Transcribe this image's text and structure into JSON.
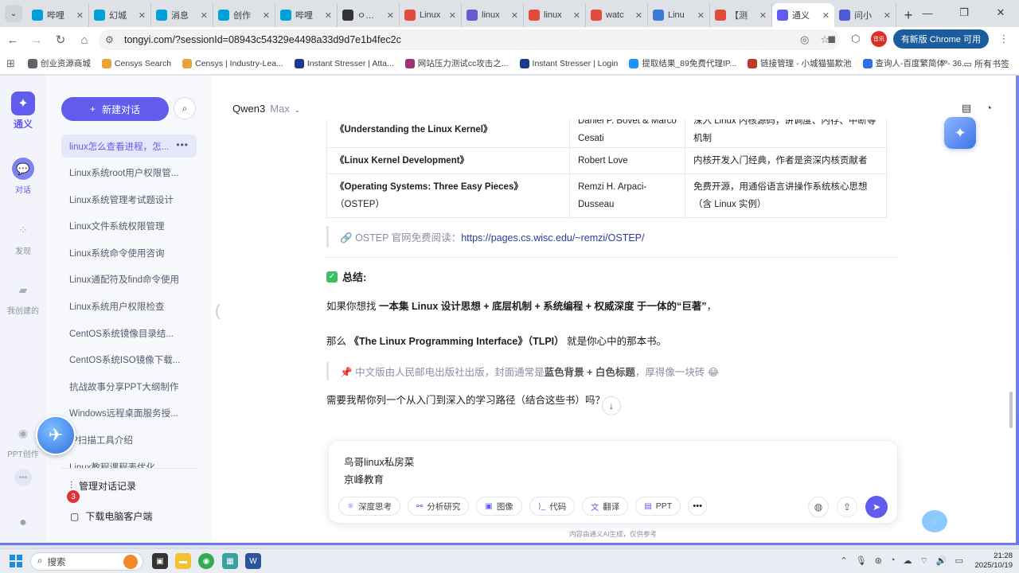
{
  "browser": {
    "tabs": [
      {
        "title": "哔哩",
        "icon": "bilibili-icon",
        "color": "#00a1d6"
      },
      {
        "title": "幻城",
        "icon": "bilibili-icon",
        "color": "#00a1d6"
      },
      {
        "title": "消息",
        "icon": "bilibili-icon",
        "color": "#00a1d6"
      },
      {
        "title": "创作",
        "icon": "bilibili-icon",
        "color": "#00a1d6"
      },
      {
        "title": "哔哩",
        "icon": "bilibili-icon",
        "color": "#00a1d6"
      },
      {
        "title": "ㅇ…",
        "icon": "grid-icon",
        "color": "#333333"
      },
      {
        "title": "Linux",
        "icon": "c-icon",
        "color": "#e34c3c"
      },
      {
        "title": "linux",
        "icon": "purple-icon",
        "color": "#6a5acd"
      },
      {
        "title": "linux",
        "icon": "c-icon",
        "color": "#e34c3c"
      },
      {
        "title": "watc",
        "icon": "c-icon",
        "color": "#e34c3c"
      },
      {
        "title": "Linu",
        "icon": "cloud-icon",
        "color": "#3a7bd5"
      },
      {
        "title": "【测",
        "icon": "c-icon",
        "color": "#e34c3c"
      },
      {
        "title": "通义",
        "icon": "tongyi-icon",
        "color": "#615ced"
      },
      {
        "title": "问小",
        "icon": "infinity-icon",
        "color": "#4f5bd5"
      }
    ],
    "active_tab_index": 12,
    "url": "tongyi.com/?sessionId=08943c54329e4498a33d9d7e1b4fec2c",
    "profile_badge": "音讯",
    "update_label": "有新版 Chrome 可用",
    "bookmarks": [
      {
        "label": "创业资源商城",
        "icon": "globe-icon",
        "color": "#5f6368"
      },
      {
        "label": "Censys Search",
        "icon": "censys-icon",
        "color": "#e8a33d"
      },
      {
        "label": "Censys | Industry-Lea...",
        "icon": "censys-icon",
        "color": "#e8a33d"
      },
      {
        "label": "Instant Stresser | Atta...",
        "icon": "stresser-icon",
        "color": "#1a3a8a"
      },
      {
        "label": "网站压力测试cc攻击之...",
        "icon": "web-icon",
        "color": "#a0307a"
      },
      {
        "label": "Instant Stresser | Login",
        "icon": "stresser-icon",
        "color": "#1a3a8a"
      },
      {
        "label": "提取结果_89免费代理IP...",
        "icon": "proxy-icon",
        "color": "#1e90ff"
      },
      {
        "label": "链接管理 - 小城猫猫欺池",
        "icon": "m-icon",
        "color": "#c0392b"
      },
      {
        "label": "查询人-百度繁简体 - 36...",
        "icon": "search-tool-icon",
        "color": "#2f6fe0"
      }
    ],
    "all_bookmarks_label": "所有书签"
  },
  "app": {
    "logo_text": "通义",
    "rail": [
      {
        "label": "对话",
        "icon": "chat-icon",
        "active": true
      },
      {
        "label": "发现",
        "icon": "discover-icon",
        "active": false
      },
      {
        "label": "我创建的",
        "icon": "folder-icon",
        "active": false
      },
      {
        "label": "PPT创作",
        "icon": "ppt-icon",
        "active": false
      }
    ],
    "new_chat_label": "新建对话",
    "conversations": [
      "linux怎么查看进程，怎...",
      "Linux系统root用户权限管...",
      "Linux系统管理考试题设计",
      "Linux文件系统权限管理",
      "Linux系统命令使用咨询",
      "Linux通配符及find命令使用",
      "Linux系统用户权限检查",
      "CentOS系统镜像目录结...",
      "CentOS系统ISO镜像下载...",
      "抗战故事分享PPT大纲制作",
      "Windows远程桌面服务授...",
      "IP扫描工具介绍",
      "Linux教程课程表优化..."
    ],
    "manage_label": "管理对话记录",
    "download_label": "下载电脑客户端",
    "notif_count": "3",
    "model_name": "Qwen3",
    "model_tier": "Max"
  },
  "message": {
    "table": [
      {
        "book": "《Understanding the Linux Kernel》",
        "sub": "",
        "author": "Daniel P. Bovet & Marco Cesati",
        "desc": "深入 Linux 内核源码，讲调度、内存、中断等机制"
      },
      {
        "book": "《Linux Kernel Development》",
        "sub": "",
        "author": "Robert Love",
        "desc": "内核开发入门经典，作者是资深内核贡献者"
      },
      {
        "book": "《Operating Systems: Three Easy Pieces》",
        "sub": "（OSTEP）",
        "author": "Remzi H. Arpaci-Dusseau",
        "desc": "免费开源，用通俗语言讲操作系统核心思想（含 Linux 实例）"
      }
    ],
    "ostep_prefix": "OSTEP 官网免费阅读：",
    "ostep_link": "https://pages.cs.wisc.edu/~remzi/OSTEP/",
    "summary_title": "总结:",
    "p1_prefix": "如果你想找 ",
    "p1_bold": "一本集 Linux 设计思想 + 底层机制 + 系统编程 + 权威深度 于一体的“巨著”",
    "p1_suffix": "，",
    "p2_prefix": "那么 ",
    "p2_bold": "《The Linux Programming Interface》（TLPI）",
    "p2_suffix": " 就是你心中的那本书。",
    "note_prefix": "中文版由人民邮电出版社出版，封面通常是",
    "note_bold": "蓝色背景 + 白色标题",
    "note_suffix": "，厚得像一块砖 😂",
    "p3": "需要我帮你列一个从入门到深入的学习路径（结合这些书）吗？"
  },
  "input": {
    "line1": "鸟哥linux私房菜",
    "line2": "京峰教育",
    "chips": [
      {
        "label": "深度思考",
        "icon": "atom-icon"
      },
      {
        "label": "分析研究",
        "icon": "research-icon"
      },
      {
        "label": "图像",
        "icon": "image-icon"
      },
      {
        "label": "代码",
        "icon": "code-icon"
      },
      {
        "label": "翻译",
        "icon": "translate-icon"
      },
      {
        "label": "PPT",
        "icon": "ppt-icon"
      }
    ],
    "disclaimer": "内容由通义AI生成，仅供参考"
  },
  "taskbar": {
    "search_placeholder": "搜索",
    "time": "21:28",
    "date": "2025/10/19"
  }
}
